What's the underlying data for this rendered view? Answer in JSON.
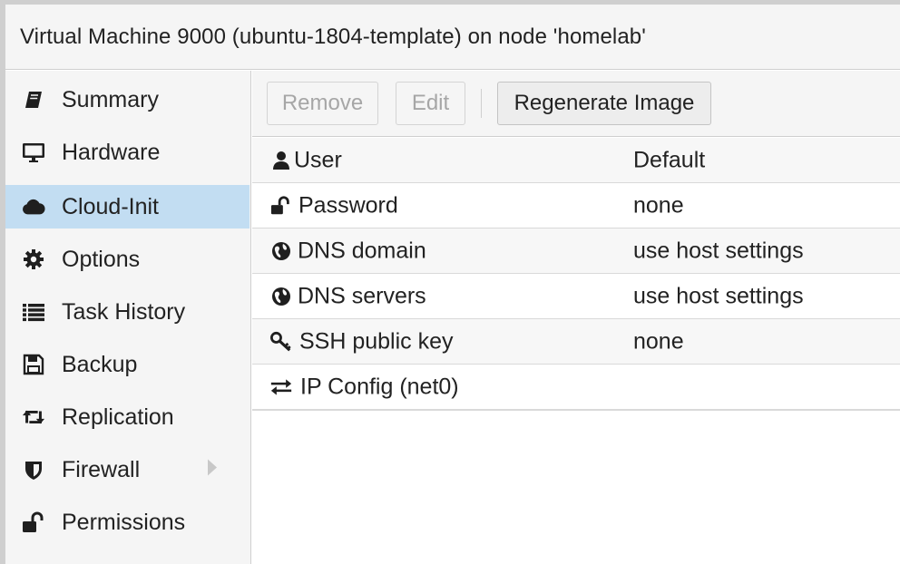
{
  "window": {
    "title": "Virtual Machine 9000 (ubuntu-1804-template) on node 'homelab'"
  },
  "sidebar": {
    "items": [
      {
        "label": "Summary",
        "icon": "book-icon",
        "active": false
      },
      {
        "label": "Hardware",
        "icon": "desktop-icon",
        "active": false
      },
      {
        "label": "Cloud-Init",
        "icon": "cloud-icon",
        "active": true
      },
      {
        "label": "Options",
        "icon": "gear-icon",
        "active": false
      },
      {
        "label": "Task History",
        "icon": "list-icon",
        "active": false
      },
      {
        "label": "Backup",
        "icon": "floppy-icon",
        "active": false
      },
      {
        "label": "Replication",
        "icon": "retweet-icon",
        "active": false
      },
      {
        "label": "Firewall",
        "icon": "shield-icon",
        "active": false,
        "has_submenu": true
      },
      {
        "label": "Permissions",
        "icon": "unlock-icon",
        "active": false
      }
    ]
  },
  "toolbar": {
    "remove_label": "Remove",
    "edit_label": "Edit",
    "regenerate_label": "Regenerate Image"
  },
  "grid": {
    "rows": [
      {
        "key": "User",
        "value": "Default",
        "icon": "user-icon"
      },
      {
        "key": "Password",
        "value": "none",
        "icon": "unlock-icon"
      },
      {
        "key": "DNS domain",
        "value": "use host settings",
        "icon": "globe-icon"
      },
      {
        "key": "DNS servers",
        "value": "use host settings",
        "icon": "globe-icon"
      },
      {
        "key": "SSH public key",
        "value": "none",
        "icon": "key-icon"
      },
      {
        "key": "IP Config (net0)",
        "value": "",
        "icon": "exchange-icon"
      }
    ]
  },
  "colors": {
    "active_nav": "#c2ddf2",
    "panel_bg": "#f5f5f5",
    "border": "#cfcfcf"
  }
}
